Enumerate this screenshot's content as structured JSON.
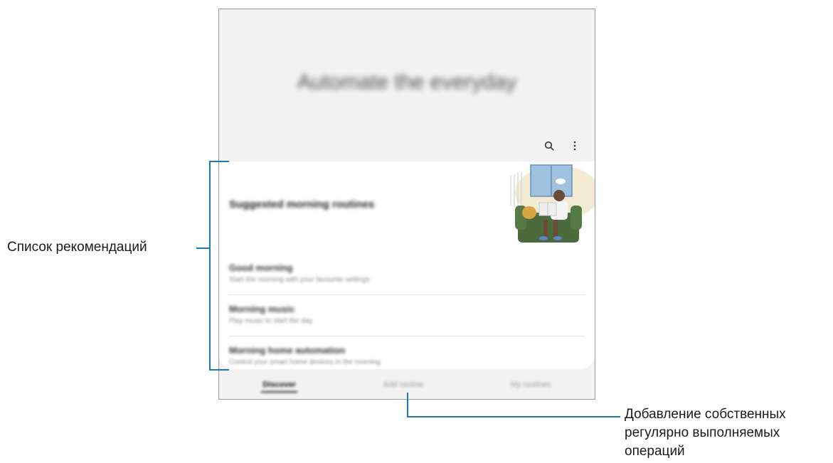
{
  "screen": {
    "hero_title": "Automate the everyday",
    "icons": {
      "search": "search-icon",
      "more": "more-options-icon"
    },
    "card": {
      "title": "Suggested morning routines",
      "items": [
        {
          "title": "Good morning",
          "subtitle": "Start the morning with your favourite settings"
        },
        {
          "title": "Morning music",
          "subtitle": "Play music to start the day"
        },
        {
          "title": "Morning home automation",
          "subtitle": "Control your smart home devices in the morning"
        }
      ]
    },
    "tabs": [
      {
        "label": "Discover",
        "active": true
      },
      {
        "label": "Add routine",
        "active": false
      },
      {
        "label": "My routines",
        "active": false
      }
    ]
  },
  "callouts": {
    "recommendations_list": "Список рекомендаций",
    "add_routines_line1": "Добавление собственных",
    "add_routines_line2": "регулярно выполняемых",
    "add_routines_line3": "операций"
  },
  "colors": {
    "accent_line": "#1f7ab4"
  }
}
